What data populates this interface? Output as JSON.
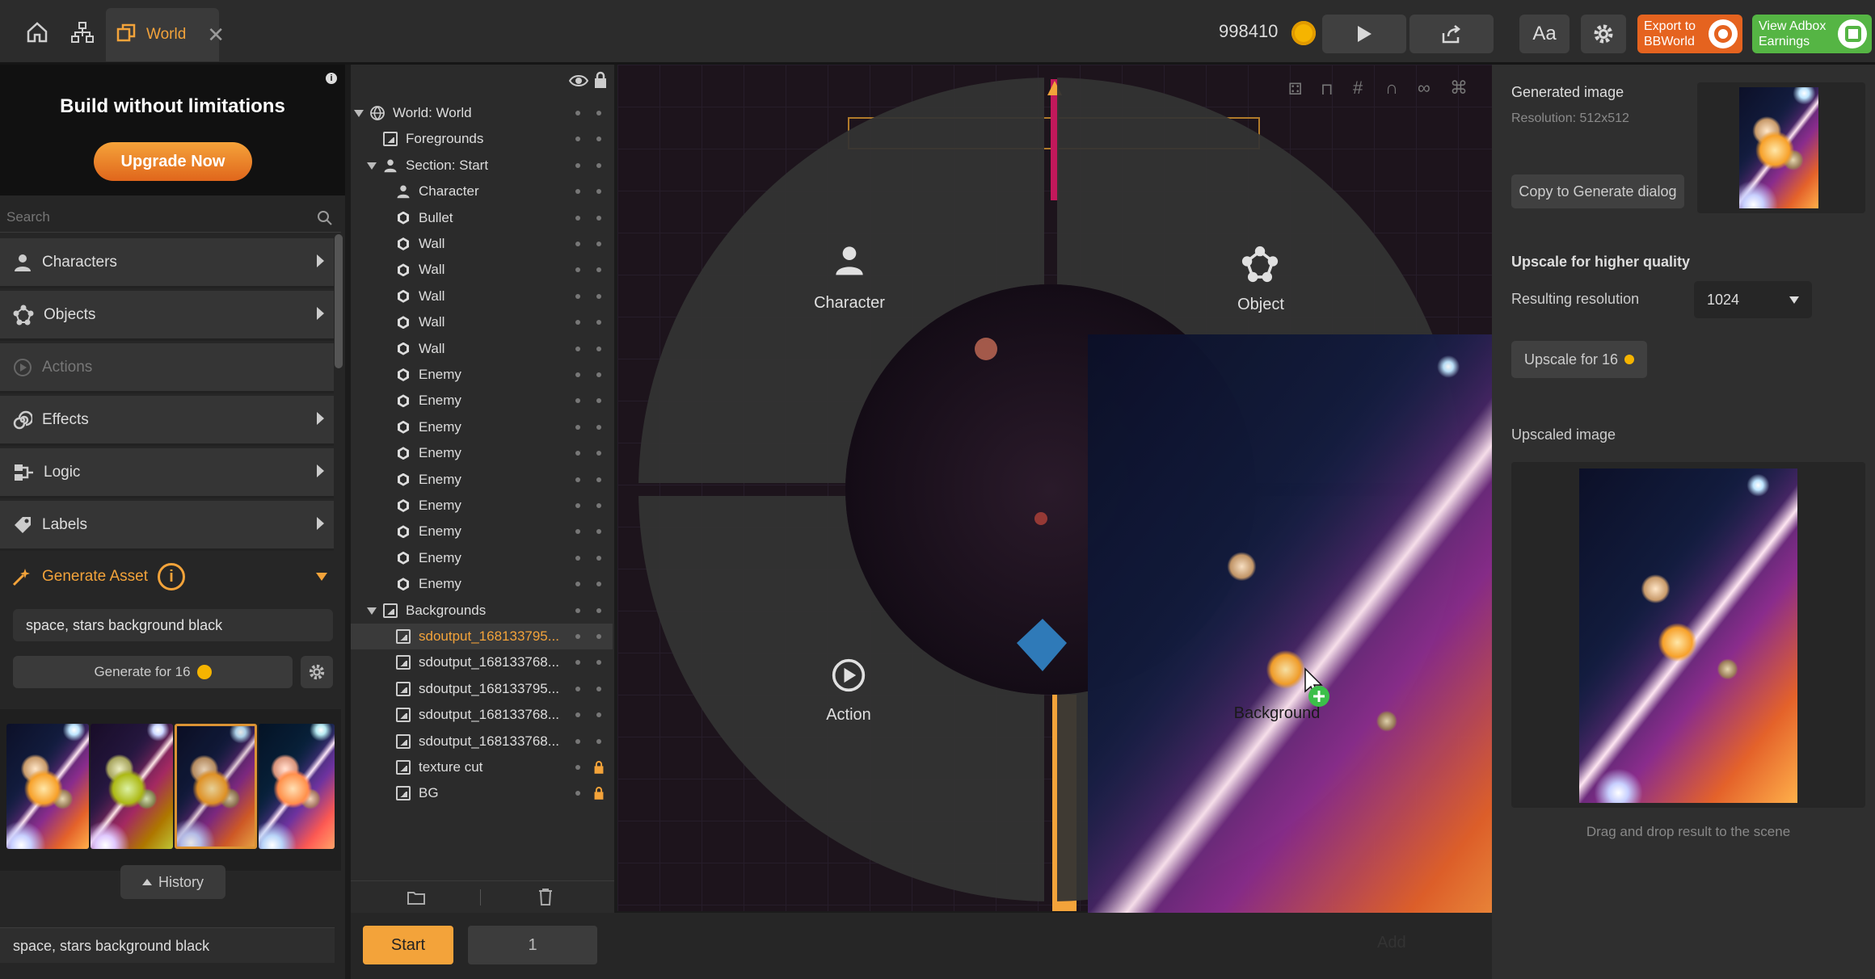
{
  "colors": {
    "accent": "#f3a33a",
    "export_btn": "#e5631f",
    "adbox_btn": "#55b544",
    "coin": "#f5b400"
  },
  "topbar": {
    "tab_label": "World",
    "coins": "998410",
    "export_label": "Export to\nBBWorld",
    "adbox_label": "View Adbox\nEarnings",
    "font_btn": "Aa"
  },
  "promo": {
    "title": "Build without limitations",
    "button": "Upgrade Now"
  },
  "search": {
    "placeholder": "Search"
  },
  "categories": [
    {
      "label": "Characters",
      "icon": "person-icon",
      "enabled": true
    },
    {
      "label": "Objects",
      "icon": "network-icon",
      "enabled": true
    },
    {
      "label": "Actions",
      "icon": "play-circle-icon",
      "enabled": false
    },
    {
      "label": "Effects",
      "icon": "spiral-icon",
      "enabled": true
    },
    {
      "label": "Logic",
      "icon": "logic-icon",
      "enabled": true
    },
    {
      "label": "Labels",
      "icon": "tag-icon",
      "enabled": true
    }
  ],
  "generate": {
    "title": "Generate Asset",
    "prompt": "space, stars background black",
    "button": "Generate for 16",
    "history": "History",
    "footer_prompt": "space, stars background black"
  },
  "tree": [
    {
      "label": "World: World",
      "icon": "globe-icon",
      "level": 0,
      "expand": true
    },
    {
      "label": "Foregrounds",
      "icon": "image-icon",
      "level": 1
    },
    {
      "label": "Section: Start",
      "icon": "person-icon",
      "level": 1,
      "expand": true
    },
    {
      "label": "Character",
      "icon": "person-icon",
      "level": 2
    },
    {
      "label": "Bullet",
      "icon": "hex-icon",
      "level": 2
    },
    {
      "label": "Wall",
      "icon": "hex-icon",
      "level": 2
    },
    {
      "label": "Wall",
      "icon": "hex-icon",
      "level": 2
    },
    {
      "label": "Wall",
      "icon": "hex-icon",
      "level": 2
    },
    {
      "label": "Wall",
      "icon": "hex-icon",
      "level": 2
    },
    {
      "label": "Wall",
      "icon": "hex-icon",
      "level": 2
    },
    {
      "label": "Enemy",
      "icon": "hex-icon",
      "level": 2
    },
    {
      "label": "Enemy",
      "icon": "hex-icon",
      "level": 2
    },
    {
      "label": "Enemy",
      "icon": "hex-icon",
      "level": 2
    },
    {
      "label": "Enemy",
      "icon": "hex-icon",
      "level": 2
    },
    {
      "label": "Enemy",
      "icon": "hex-icon",
      "level": 2
    },
    {
      "label": "Enemy",
      "icon": "hex-icon",
      "level": 2
    },
    {
      "label": "Enemy",
      "icon": "hex-icon",
      "level": 2
    },
    {
      "label": "Enemy",
      "icon": "hex-icon",
      "level": 2
    },
    {
      "label": "Enemy",
      "icon": "hex-icon",
      "level": 2
    },
    {
      "label": "Backgrounds",
      "icon": "image-icon",
      "level": 1,
      "expand": true
    },
    {
      "label": "sdoutput_168133795...",
      "icon": "image-icon",
      "level": 2,
      "selected": true
    },
    {
      "label": "sdoutput_168133768...",
      "icon": "image-icon",
      "level": 2
    },
    {
      "label": "sdoutput_168133795...",
      "icon": "image-icon",
      "level": 2
    },
    {
      "label": "sdoutput_168133768...",
      "icon": "image-icon",
      "level": 2
    },
    {
      "label": "sdoutput_168133768...",
      "icon": "image-icon",
      "level": 2
    },
    {
      "label": "texture cut",
      "icon": "image-icon",
      "level": 2,
      "locked": true
    },
    {
      "label": "BG",
      "icon": "image-icon",
      "level": 2,
      "locked": true
    }
  ],
  "radial": {
    "character": "Character",
    "object": "Object",
    "action": "Action",
    "background": "Background"
  },
  "bottom": {
    "start": "Start",
    "page": "1",
    "add": "Add"
  },
  "right": {
    "generated_title": "Generated image",
    "resolution": "Resolution: 512x512",
    "copy_button": "Copy to Generate dialog",
    "upscale_title": "Upscale for higher quality",
    "resulting_label": "Resulting resolution",
    "resulting_value": "1024",
    "upscale_button": "Upscale for 16",
    "upscaled_title": "Upscaled image",
    "hint": "Drag and drop result to the scene"
  }
}
